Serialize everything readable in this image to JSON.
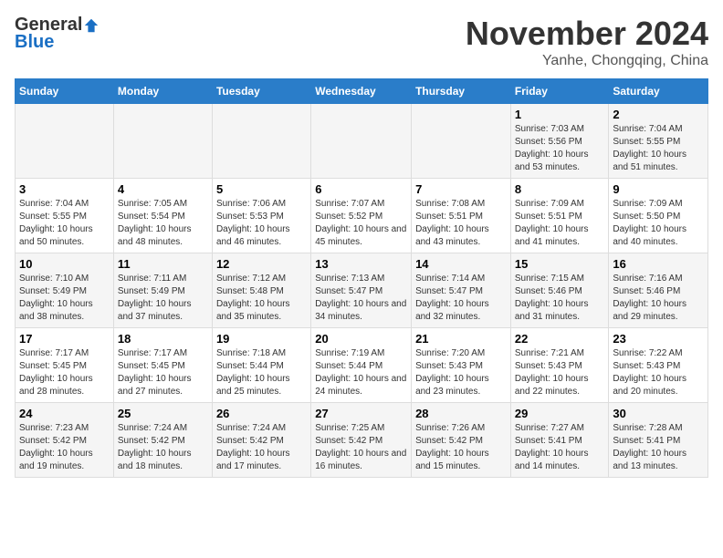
{
  "header": {
    "logo_general": "General",
    "logo_blue": "Blue",
    "month": "November 2024",
    "location": "Yanhe, Chongqing, China"
  },
  "days_of_week": [
    "Sunday",
    "Monday",
    "Tuesday",
    "Wednesday",
    "Thursday",
    "Friday",
    "Saturday"
  ],
  "weeks": [
    [
      {
        "day": "",
        "info": ""
      },
      {
        "day": "",
        "info": ""
      },
      {
        "day": "",
        "info": ""
      },
      {
        "day": "",
        "info": ""
      },
      {
        "day": "",
        "info": ""
      },
      {
        "day": "1",
        "info": "Sunrise: 7:03 AM\nSunset: 5:56 PM\nDaylight: 10 hours and 53 minutes."
      },
      {
        "day": "2",
        "info": "Sunrise: 7:04 AM\nSunset: 5:55 PM\nDaylight: 10 hours and 51 minutes."
      }
    ],
    [
      {
        "day": "3",
        "info": "Sunrise: 7:04 AM\nSunset: 5:55 PM\nDaylight: 10 hours and 50 minutes."
      },
      {
        "day": "4",
        "info": "Sunrise: 7:05 AM\nSunset: 5:54 PM\nDaylight: 10 hours and 48 minutes."
      },
      {
        "day": "5",
        "info": "Sunrise: 7:06 AM\nSunset: 5:53 PM\nDaylight: 10 hours and 46 minutes."
      },
      {
        "day": "6",
        "info": "Sunrise: 7:07 AM\nSunset: 5:52 PM\nDaylight: 10 hours and 45 minutes."
      },
      {
        "day": "7",
        "info": "Sunrise: 7:08 AM\nSunset: 5:51 PM\nDaylight: 10 hours and 43 minutes."
      },
      {
        "day": "8",
        "info": "Sunrise: 7:09 AM\nSunset: 5:51 PM\nDaylight: 10 hours and 41 minutes."
      },
      {
        "day": "9",
        "info": "Sunrise: 7:09 AM\nSunset: 5:50 PM\nDaylight: 10 hours and 40 minutes."
      }
    ],
    [
      {
        "day": "10",
        "info": "Sunrise: 7:10 AM\nSunset: 5:49 PM\nDaylight: 10 hours and 38 minutes."
      },
      {
        "day": "11",
        "info": "Sunrise: 7:11 AM\nSunset: 5:49 PM\nDaylight: 10 hours and 37 minutes."
      },
      {
        "day": "12",
        "info": "Sunrise: 7:12 AM\nSunset: 5:48 PM\nDaylight: 10 hours and 35 minutes."
      },
      {
        "day": "13",
        "info": "Sunrise: 7:13 AM\nSunset: 5:47 PM\nDaylight: 10 hours and 34 minutes."
      },
      {
        "day": "14",
        "info": "Sunrise: 7:14 AM\nSunset: 5:47 PM\nDaylight: 10 hours and 32 minutes."
      },
      {
        "day": "15",
        "info": "Sunrise: 7:15 AM\nSunset: 5:46 PM\nDaylight: 10 hours and 31 minutes."
      },
      {
        "day": "16",
        "info": "Sunrise: 7:16 AM\nSunset: 5:46 PM\nDaylight: 10 hours and 29 minutes."
      }
    ],
    [
      {
        "day": "17",
        "info": "Sunrise: 7:17 AM\nSunset: 5:45 PM\nDaylight: 10 hours and 28 minutes."
      },
      {
        "day": "18",
        "info": "Sunrise: 7:17 AM\nSunset: 5:45 PM\nDaylight: 10 hours and 27 minutes."
      },
      {
        "day": "19",
        "info": "Sunrise: 7:18 AM\nSunset: 5:44 PM\nDaylight: 10 hours and 25 minutes."
      },
      {
        "day": "20",
        "info": "Sunrise: 7:19 AM\nSunset: 5:44 PM\nDaylight: 10 hours and 24 minutes."
      },
      {
        "day": "21",
        "info": "Sunrise: 7:20 AM\nSunset: 5:43 PM\nDaylight: 10 hours and 23 minutes."
      },
      {
        "day": "22",
        "info": "Sunrise: 7:21 AM\nSunset: 5:43 PM\nDaylight: 10 hours and 22 minutes."
      },
      {
        "day": "23",
        "info": "Sunrise: 7:22 AM\nSunset: 5:43 PM\nDaylight: 10 hours and 20 minutes."
      }
    ],
    [
      {
        "day": "24",
        "info": "Sunrise: 7:23 AM\nSunset: 5:42 PM\nDaylight: 10 hours and 19 minutes."
      },
      {
        "day": "25",
        "info": "Sunrise: 7:24 AM\nSunset: 5:42 PM\nDaylight: 10 hours and 18 minutes."
      },
      {
        "day": "26",
        "info": "Sunrise: 7:24 AM\nSunset: 5:42 PM\nDaylight: 10 hours and 17 minutes."
      },
      {
        "day": "27",
        "info": "Sunrise: 7:25 AM\nSunset: 5:42 PM\nDaylight: 10 hours and 16 minutes."
      },
      {
        "day": "28",
        "info": "Sunrise: 7:26 AM\nSunset: 5:42 PM\nDaylight: 10 hours and 15 minutes."
      },
      {
        "day": "29",
        "info": "Sunrise: 7:27 AM\nSunset: 5:41 PM\nDaylight: 10 hours and 14 minutes."
      },
      {
        "day": "30",
        "info": "Sunrise: 7:28 AM\nSunset: 5:41 PM\nDaylight: 10 hours and 13 minutes."
      }
    ]
  ]
}
